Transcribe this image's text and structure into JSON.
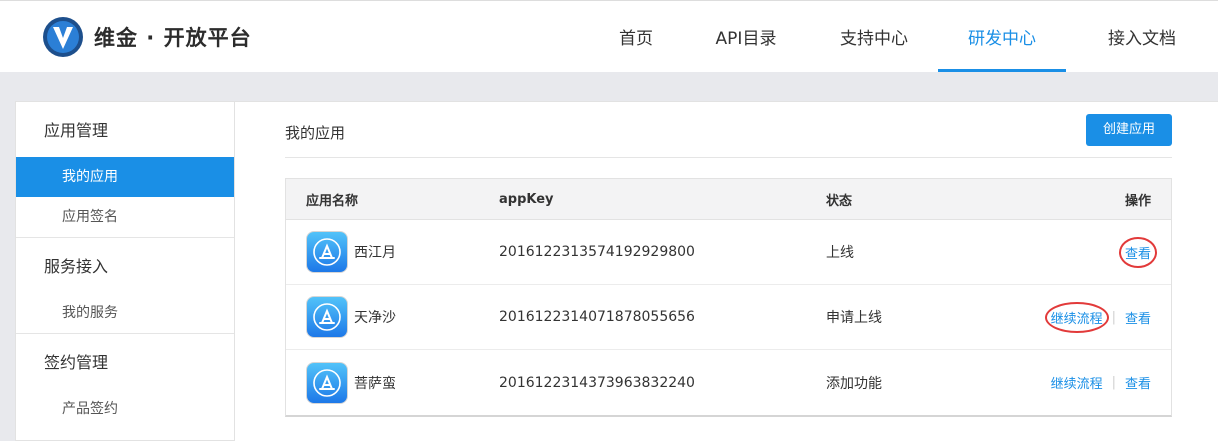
{
  "brand": {
    "name": "维金 · 开放平台"
  },
  "nav": [
    {
      "label": "首页",
      "active": false
    },
    {
      "label": "API目录",
      "active": false
    },
    {
      "label": "支持中心",
      "active": false
    },
    {
      "label": "研发中心",
      "active": true
    },
    {
      "label": "接入文档",
      "active": false
    }
  ],
  "sidebar": {
    "groups": [
      {
        "title": "应用管理",
        "items": [
          {
            "label": "我的应用",
            "active": true
          },
          {
            "label": "应用签名",
            "active": false
          }
        ]
      },
      {
        "title": "服务接入",
        "items": [
          {
            "label": "我的服务",
            "active": false
          }
        ]
      },
      {
        "title": "签约管理",
        "items": [
          {
            "label": "产品签约",
            "active": false
          }
        ]
      }
    ]
  },
  "main": {
    "title": "我的应用",
    "create_button": "创建应用",
    "table": {
      "headers": {
        "name": "应用名称",
        "key": "appKey",
        "status": "状态",
        "ops": "操作"
      },
      "rows": [
        {
          "name": "西江月",
          "key": "20161223135741929298​00",
          "status": "上线",
          "ops": [
            "查看"
          ],
          "icon": "app-store-icon"
        },
        {
          "name": "天净沙",
          "key": "20161223140718780556​56",
          "status": "申请上线",
          "ops": [
            "继续流程",
            "查看"
          ],
          "icon": "app-store-icon"
        },
        {
          "name": "菩萨蛮",
          "key": "20161223143739638322​40",
          "status": "添加功能",
          "ops": [
            "继续流程",
            "查看"
          ],
          "icon": "app-store-icon"
        }
      ]
    }
  },
  "colors": {
    "accent": "#1a8fe6",
    "highlight": "#e23a3a"
  }
}
